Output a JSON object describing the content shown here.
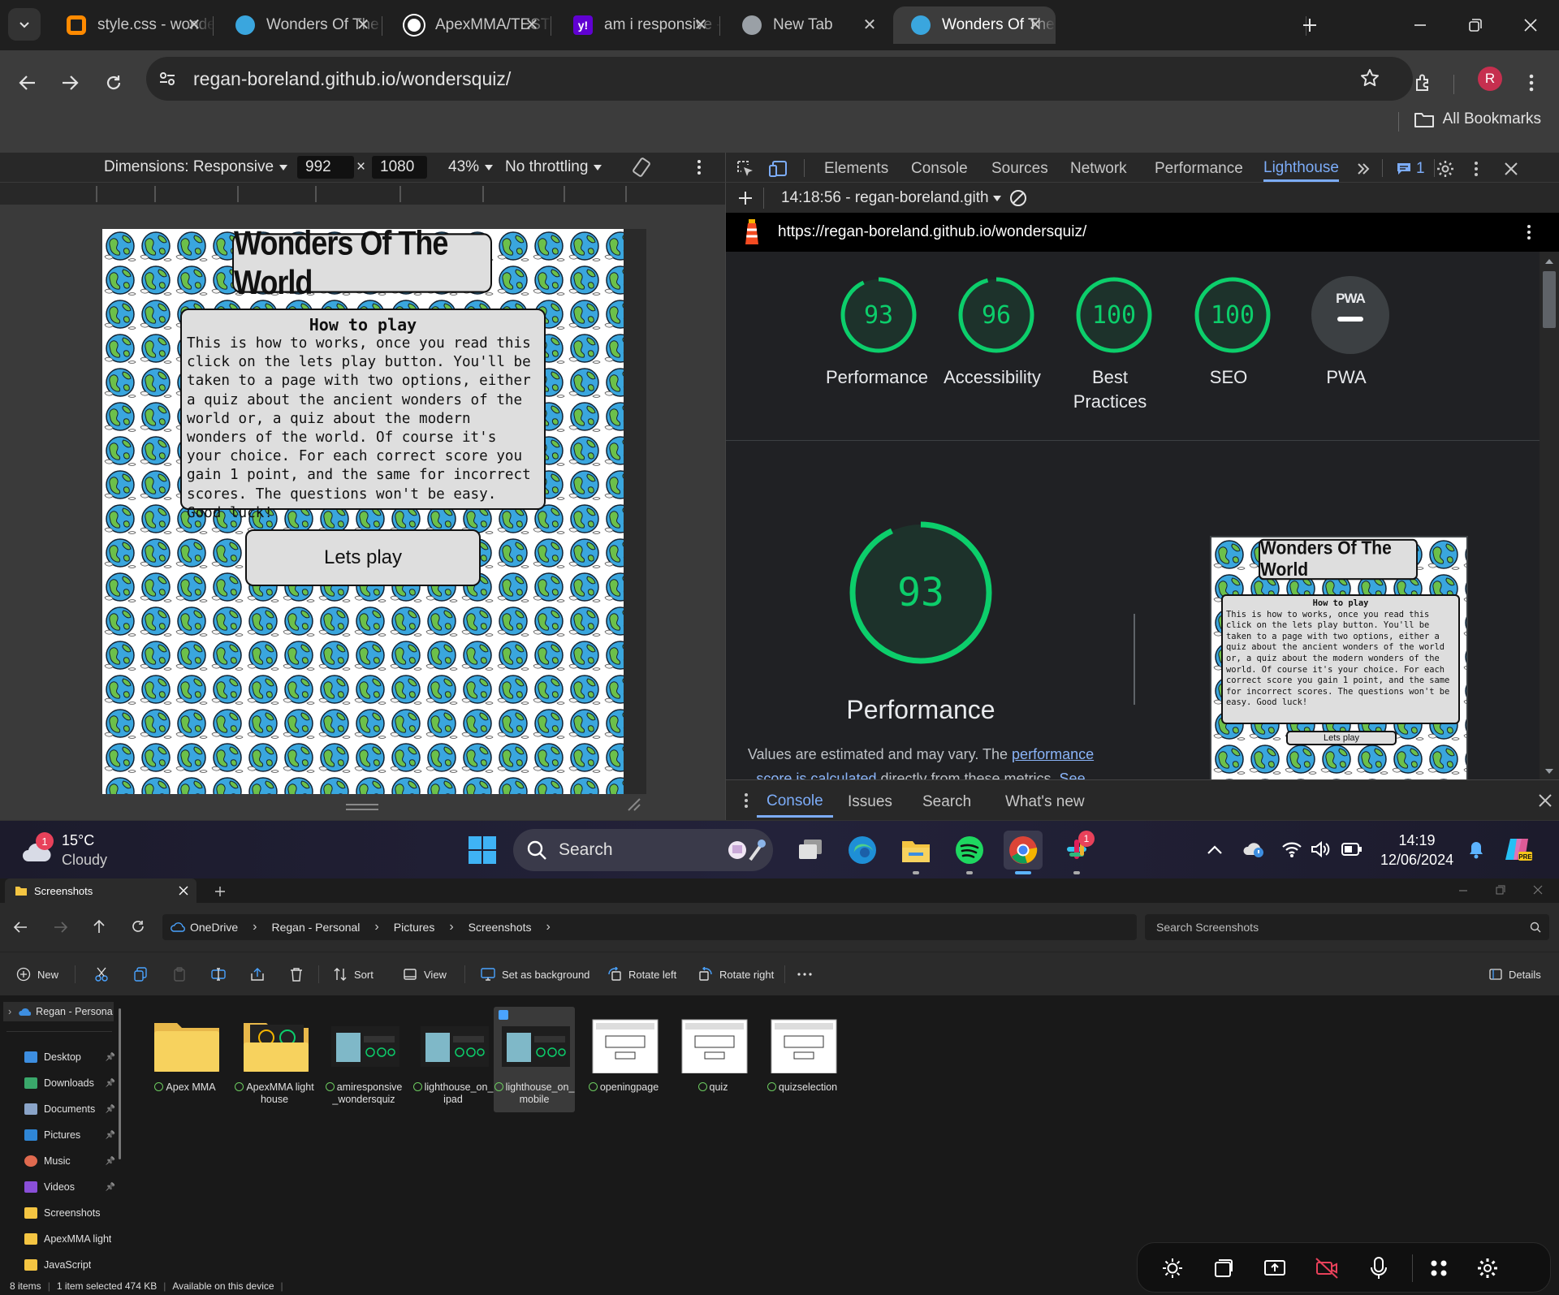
{
  "browser": {
    "tabs": [
      {
        "title": "style.css - wondersquiz",
        "favicon": "gitpod-icon",
        "color": "#ff8a00"
      },
      {
        "title": "Wonders Of The World",
        "favicon": "globe-favicon",
        "color": "#3aa6de"
      },
      {
        "title": "ApexMMA/TESTING",
        "favicon": "github-icon",
        "color": "#ffffff"
      },
      {
        "title": "am i responsive - Yahoo",
        "favicon": "yahoo-icon",
        "color": "#6001d2"
      },
      {
        "title": "New Tab",
        "favicon": "chrome-newtab-icon",
        "color": "#9aa0a6"
      },
      {
        "title": "Wonders Of The World",
        "favicon": "globe-favicon",
        "color": "#3aa6de"
      }
    ],
    "active_tab_index": 5,
    "url": "regan-boreland.github.io/wondersquiz/",
    "profile_initial": "R",
    "bookmarks_label": "All Bookmarks"
  },
  "device_toolbar": {
    "dimensions": "Dimensions: Responsive",
    "width": "992",
    "times": "×",
    "height": "1080",
    "zoom": "43%",
    "throttling": "No throttling"
  },
  "site": {
    "title": "Wonders Of The World",
    "how_heading": "How to play",
    "how_text": "This is how to works, once you read this click on the lets play button. You'll be taken to a page with two options, either a quiz about the ancient wonders of the world or, a quiz about the modern wonders of the world. Of course it's your choice. For each correct score you gain 1 point, and the same for incorrect scores. The questions won't be easy. Good luck!",
    "button": "Lets play"
  },
  "devtools": {
    "tabs": [
      "Elements",
      "Console",
      "Sources",
      "Network",
      "Performance",
      "Lighthouse"
    ],
    "active_tab": "Lighthouse",
    "issues_count": "1",
    "report_label": "14:18:56 - regan-boreland.gith",
    "report_url": "https://regan-boreland.github.io/wondersquiz/",
    "scores": [
      {
        "score": 93,
        "label": "Performance"
      },
      {
        "score": 96,
        "label": "Accessibility"
      },
      {
        "score": 100,
        "label": "Best Practices"
      },
      {
        "score": 100,
        "label": "SEO"
      },
      {
        "score": null,
        "label": "PWA"
      }
    ],
    "pwa_badge": "PWA",
    "main_score": "93",
    "main_title": "Performance",
    "desc_prefix": "Values are estimated and may vary. The ",
    "desc_link": "performance score is calculated",
    "desc_mid": " directly from these metrics. ",
    "desc_see": "See",
    "drawer_tabs": [
      "Console",
      "Issues",
      "Search",
      "What's new"
    ],
    "accent": "#0cce6b"
  },
  "taskbar": {
    "weather_temp": "15°C",
    "weather_desc": "Cloudy",
    "weather_badge": "1",
    "search_placeholder": "Search",
    "slack_badge": "1",
    "time": "14:19",
    "date": "12/06/2024"
  },
  "explorer": {
    "tab_title": "Screenshots",
    "breadcrumb": [
      "OneDrive",
      "Regan - Personal",
      "Pictures",
      "Screenshots"
    ],
    "search_placeholder": "Search Screenshots",
    "commands": [
      "New",
      "Sort",
      "View",
      "Set as background",
      "Rotate left",
      "Rotate right",
      "Details"
    ],
    "sidebar_root": "Regan - Persona",
    "sidebar": [
      {
        "label": "Desktop",
        "pinned": true,
        "color": "#3d8ee0"
      },
      {
        "label": "Downloads",
        "pinned": true,
        "color": "#3aa86b"
      },
      {
        "label": "Documents",
        "pinned": true,
        "color": "#8aa4c8"
      },
      {
        "label": "Pictures",
        "pinned": true,
        "color": "#2f86d6"
      },
      {
        "label": "Music",
        "pinned": true,
        "color": "#e06a4f"
      },
      {
        "label": "Videos",
        "pinned": true,
        "color": "#8a4fd8"
      },
      {
        "label": "Screenshots",
        "pinned": false,
        "color": "#f4c542"
      },
      {
        "label": "ApexMMA light",
        "pinned": false,
        "color": "#f4c542"
      },
      {
        "label": "JavaScript",
        "pinned": false,
        "color": "#f4c542"
      }
    ],
    "files": [
      {
        "name": "Apex MMA",
        "kind": "folder"
      },
      {
        "name": "ApexMMA lighthouse",
        "kind": "folder-thumb"
      },
      {
        "name": "amiresponsive_wondersquiz",
        "kind": "image-dark"
      },
      {
        "name": "lighthouse_on_ipad",
        "kind": "image-dark"
      },
      {
        "name": "lighthouse_on_mobile",
        "kind": "image-dark",
        "selected": true
      },
      {
        "name": "openingpage",
        "kind": "image-light"
      },
      {
        "name": "quiz",
        "kind": "image-light"
      },
      {
        "name": "quizselection",
        "kind": "image-light"
      }
    ],
    "status_items": "8 items",
    "status_selected": "1 item selected  474 KB",
    "status_available": "Available on this device"
  }
}
